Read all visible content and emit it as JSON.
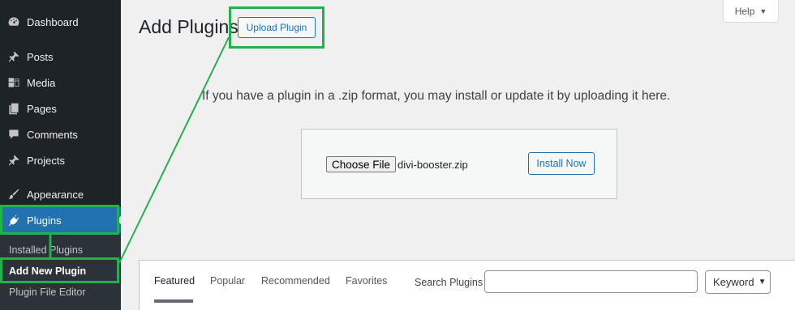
{
  "sidebar": {
    "items": [
      {
        "label": "Dashboard",
        "icon": "dashboard-icon"
      },
      {
        "label": "Posts",
        "icon": "pin-icon"
      },
      {
        "label": "Media",
        "icon": "media-icon"
      },
      {
        "label": "Pages",
        "icon": "pages-icon"
      },
      {
        "label": "Comments",
        "icon": "comment-icon"
      },
      {
        "label": "Projects",
        "icon": "pin-icon"
      },
      {
        "label": "Appearance",
        "icon": "brush-icon"
      },
      {
        "label": "Plugins",
        "icon": "plugin-icon"
      }
    ],
    "submenu": [
      "Installed Plugins",
      "Add New Plugin",
      "Plugin File Editor"
    ]
  },
  "header": {
    "title": "Add Plugins",
    "upload_button": "Upload Plugin",
    "help_button": "Help",
    "help_caret": "▼"
  },
  "upload": {
    "description": "If you have a plugin in a .zip format, you may install or update it by uploading it here.",
    "choose_file": "Choose File",
    "file_name": "divi-booster.zip",
    "install_button": "Install Now"
  },
  "filter": {
    "tabs": [
      "Featured",
      "Popular",
      "Recommended",
      "Favorites"
    ],
    "active_tab": "Featured",
    "search_label": "Search Plugins",
    "search_value": "",
    "select_value": "Keyword",
    "select_caret": "⌄"
  },
  "colors": {
    "sidebar_bg": "#1d2327",
    "accent": "#2271b1",
    "annotation": "#22b14c"
  }
}
